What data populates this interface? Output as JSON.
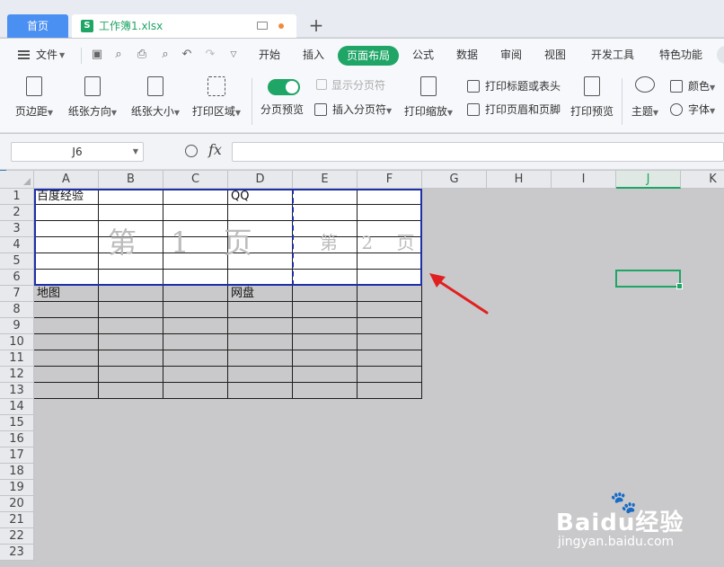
{
  "tabs": {
    "home": "首页",
    "file": "工作簿1.xlsx",
    "add": "+"
  },
  "menu": {
    "file": "文件",
    "items": [
      "开始",
      "插入",
      "页面布局",
      "公式",
      "数据",
      "审阅",
      "视图",
      "开发工具",
      "特色功能"
    ],
    "active": "页面布局"
  },
  "ribbon": {
    "margins": "页边距",
    "orientation": "纸张方向",
    "size": "纸张大小",
    "print_area": "打印区域",
    "page_break_preview": "分页预览",
    "show_page_breaks": "显示分页符",
    "insert_page_break": "插入分页符",
    "print_scaling": "打印缩放",
    "print_titles": "打印标题或表头",
    "print_header_footer": "打印页眉和页脚",
    "print_preview": "打印预览",
    "theme": "主题",
    "color": "颜色",
    "font": "字体"
  },
  "formula_bar": {
    "cell_ref": "J6",
    "fx": "fx",
    "content": ""
  },
  "sheet": {
    "columns": [
      "A",
      "B",
      "C",
      "D",
      "E",
      "F",
      "G",
      "H",
      "I",
      "J",
      "K"
    ],
    "active_column": "J",
    "rows": [
      "1",
      "2",
      "3",
      "4",
      "5",
      "6",
      "7",
      "8",
      "9",
      "10",
      "11",
      "12",
      "13",
      "14",
      "15",
      "16",
      "17",
      "18",
      "19",
      "20",
      "21",
      "22",
      "23"
    ],
    "cells": {
      "A1": "百度经验",
      "D1": "QQ",
      "A7": "地图",
      "D7": "网盘"
    },
    "page1_label": "第 1 页",
    "page2_label": "第 2 页"
  },
  "watermark": {
    "brand": "Baidu经验",
    "url": "jingyan.baidu.com"
  },
  "colors": {
    "accent": "#1fa566",
    "print_border": "#1e2fa8",
    "arrow": "#e02020"
  }
}
